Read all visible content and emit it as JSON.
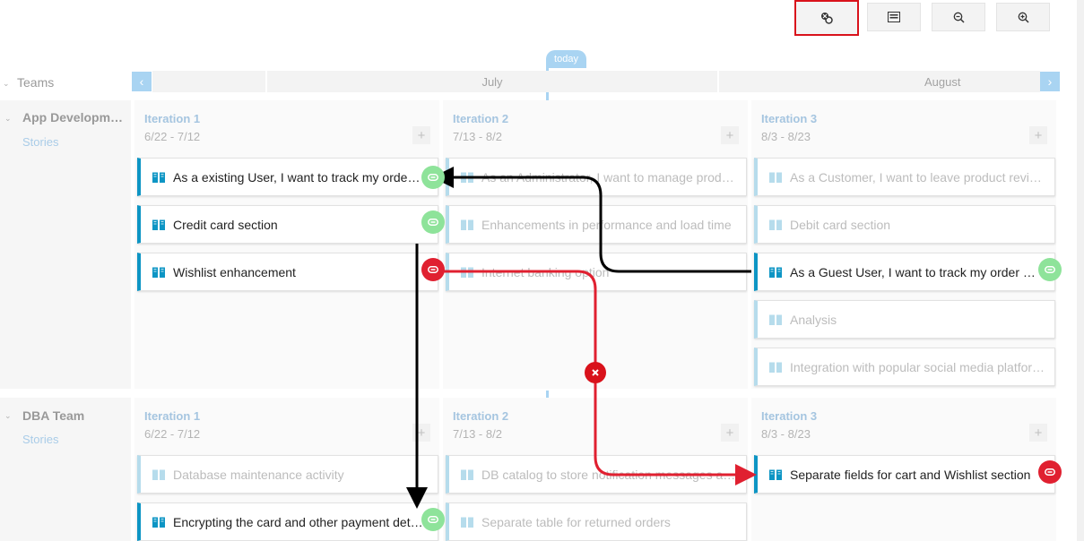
{
  "toolbar": {
    "buttons": [
      {
        "name": "dependency-view-icon",
        "active": true
      },
      {
        "name": "card-view-icon",
        "active": false
      },
      {
        "name": "zoom-out-icon",
        "active": false
      },
      {
        "name": "zoom-in-icon",
        "active": false
      }
    ]
  },
  "timeline": {
    "today_label": "today",
    "months": [
      "July",
      "August"
    ],
    "prev_arrow": "‹",
    "next_arrow": "›"
  },
  "teams_header": "Teams",
  "teams": [
    {
      "name": "App Development",
      "sub": "Stories",
      "iterations": [
        {
          "title": "Iteration 1",
          "dates": "6/22 - 7/12",
          "plus": "+"
        },
        {
          "title": "Iteration 2",
          "dates": "7/13 - 8/2",
          "plus": "+"
        },
        {
          "title": "Iteration 3",
          "dates": "8/3 - 8/23",
          "plus": "+"
        }
      ],
      "cards": [
        [
          "As a existing User, I want to track my order status",
          "Credit card section",
          "Wishlist enhancement"
        ],
        [
          "As an Administrator, I want to manage product inventory",
          "Enhancements in performance and load time",
          "Internet banking option"
        ],
        [
          "As a Customer, I want to leave product reviews",
          "Debit card section",
          "As a Guest User, I want to track my order without login",
          "Analysis",
          "Integration with popular social media platforms"
        ]
      ]
    },
    {
      "name": "DBA Team",
      "sub": "Stories",
      "iterations": [
        {
          "title": "Iteration 1",
          "dates": "6/22 - 7/12",
          "plus": "+"
        },
        {
          "title": "Iteration 2",
          "dates": "7/13 - 8/2",
          "plus": "+"
        },
        {
          "title": "Iteration 3",
          "dates": "8/3 - 8/23",
          "plus": "+"
        }
      ],
      "cards": [
        [
          "Database maintenance activity",
          "Encrypting the card and other payment details"
        ],
        [
          "DB catalog to store notification messages and alerts",
          "Separate table for returned orders"
        ],
        [
          "Separate fields for cart and Wishlist section"
        ]
      ]
    }
  ],
  "colors": {
    "accent": "#0d95c4",
    "link_ok": "#8ee39a",
    "link_error": "#e02030",
    "today": "#a9d4f2"
  }
}
